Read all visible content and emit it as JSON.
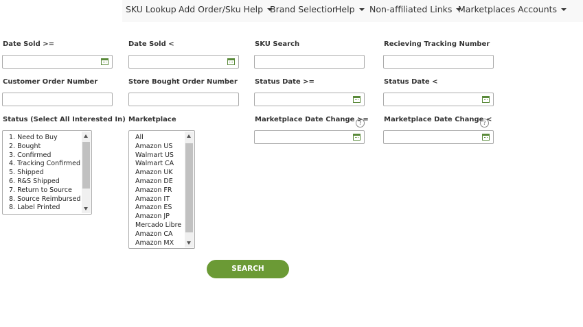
{
  "nav": {
    "sku_lookup": "SKU Lookup",
    "add_order_help": "Add Order/Sku Help",
    "brand_selection": "Brand Selection",
    "help": "Help",
    "non_affiliated": "Non-affiliated Links",
    "marketplaces_accounts": "Marketplaces Accounts"
  },
  "labels": {
    "date_sold_from": "Date Sold >=",
    "date_sold_to": "Date Sold <",
    "sku_search": "SKU Search",
    "receiving_tracking": "Recieving Tracking Number",
    "customer_order": "Customer Order Number",
    "store_bought_order": "Store Bought Order Number",
    "status_date_from": "Status Date >=",
    "status_date_to": "Status Date <",
    "status_select": "Status (Select All Interested In)",
    "marketplace": "Marketplace",
    "mp_date_change_from": "Marketplace Date Change >=",
    "mp_date_change_to": "Marketplace Date Change <"
  },
  "help_glyph": "?",
  "status_options": [
    "1. Need to Buy",
    "2. Bought",
    "3. Confirmed",
    "4. Tracking Confirmed",
    "5. Shipped",
    "6. R&S Shipped",
    "7. Return to Source",
    "8. Source Reimbursed",
    "8. Label Printed"
  ],
  "marketplace_options": [
    "All",
    "Amazon US",
    "Walmart US",
    "Walmart CA",
    "Amazon UK",
    "Amazon DE",
    "Amazon FR",
    "Amazon IT",
    "Amazon ES",
    "Amazon JP",
    "Mercado Libre",
    "Amazon CA",
    "Amazon MX"
  ],
  "search_button": "SEARCH",
  "colors": {
    "accent_green": "#6b9a35",
    "navbar_bg": "#f8f8f8"
  },
  "icons": {
    "calendar": "calendar-icon",
    "help": "help-icon",
    "caret": "caret-down-icon"
  }
}
